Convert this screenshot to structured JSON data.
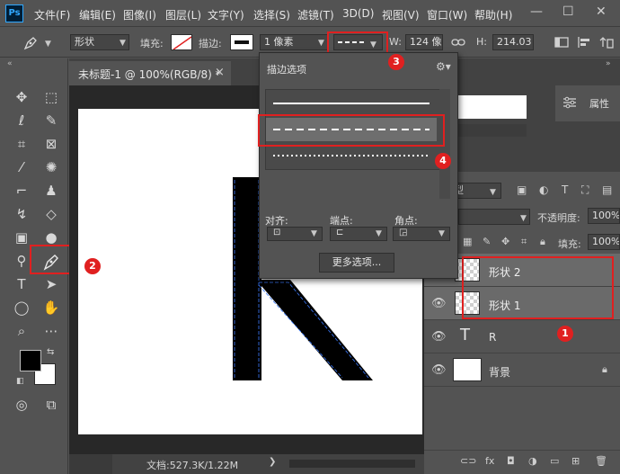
{
  "app": {
    "logo": "Ps"
  },
  "menu": [
    "文件(F)",
    "编辑(E)",
    "图像(I)",
    "图层(L)",
    "文字(Y)",
    "选择(S)",
    "滤镜(T)",
    "3D(D)",
    "视图(V)",
    "窗口(W)",
    "帮助(H)"
  ],
  "window_controls": {
    "minimize": "—",
    "maximize": "☐",
    "close": "✕"
  },
  "options": {
    "mode": "形状",
    "fill_label": "填充:",
    "stroke_label": "描边:",
    "stroke_width": "1 像素",
    "width_label": "W:",
    "width_value": "124 像",
    "height_label": "H:",
    "height_value": "214.03"
  },
  "document": {
    "tab_title": "未标题-1 @ 100%(RGB/8) *",
    "close": "×",
    "letter": "R"
  },
  "stroke_options": {
    "title": "描边选项",
    "align_label": "对齐:",
    "caps_label": "端点:",
    "corners_label": "角点:",
    "more_button": "更多选项..."
  },
  "properties": {
    "label": "属性"
  },
  "layers_panel": {
    "kind_filter": "型",
    "opacity_label": "不透明度:",
    "opacity_value": "100%",
    "fill_label": "填充:",
    "fill_value": "100%",
    "layers": [
      {
        "name": "形状 2",
        "type": "shape"
      },
      {
        "name": "形状 1",
        "type": "shape"
      },
      {
        "name": "R",
        "type": "text"
      },
      {
        "name": "背景",
        "type": "background"
      }
    ]
  },
  "status": {
    "doc_info": "文档:527.3K/1.22M"
  },
  "annotations": [
    "1",
    "2",
    "3",
    "4"
  ],
  "colors": {
    "annotation_red": "#e02020",
    "path_blue": "#3b7bff",
    "canvas": "#ffffff"
  }
}
